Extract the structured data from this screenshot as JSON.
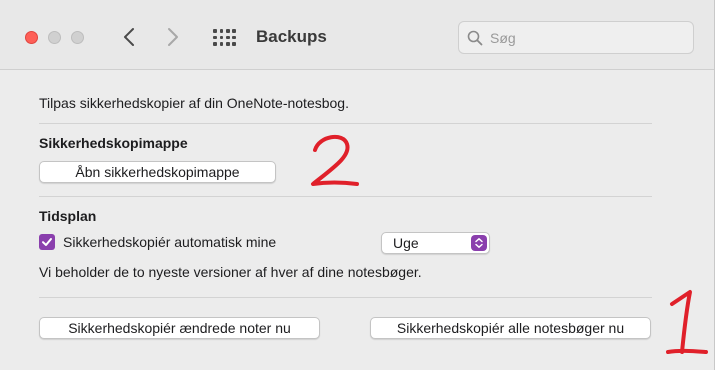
{
  "window": {
    "title": "Backups",
    "search_placeholder": "Søg"
  },
  "content": {
    "intro": "Tilpas sikkerhedskopier af din OneNote-notesbog.",
    "folder_section": {
      "heading": "Sikkerhedskopimappe",
      "open_button": "Åbn sikkerhedskopimappe"
    },
    "schedule_section": {
      "heading": "Tidsplan",
      "auto_checkbox": {
        "label": "Sikkerhedskopiér automatisk mine",
        "checked": true
      },
      "frequency": {
        "selected": "Uge"
      },
      "note": "Vi beholder de to nyeste versioner af hver af dine notesbøger."
    },
    "actions": {
      "backup_changed": "Sikkerhedskopiér ændrede noter nu",
      "backup_all": "Sikkerhedskopiér alle notesbøger nu"
    }
  },
  "annotations": {
    "mark_1": "1",
    "mark_2": "2",
    "color": "#e0202a"
  },
  "colors": {
    "accent": "#8a3fad",
    "close_button": "#fe5f57"
  },
  "icons": [
    "close-button",
    "minimize-button",
    "zoom-button",
    "chevron-left-icon",
    "chevron-right-icon",
    "grid-icon",
    "search-icon",
    "checkmark-icon",
    "updown-chevron-icon"
  ]
}
